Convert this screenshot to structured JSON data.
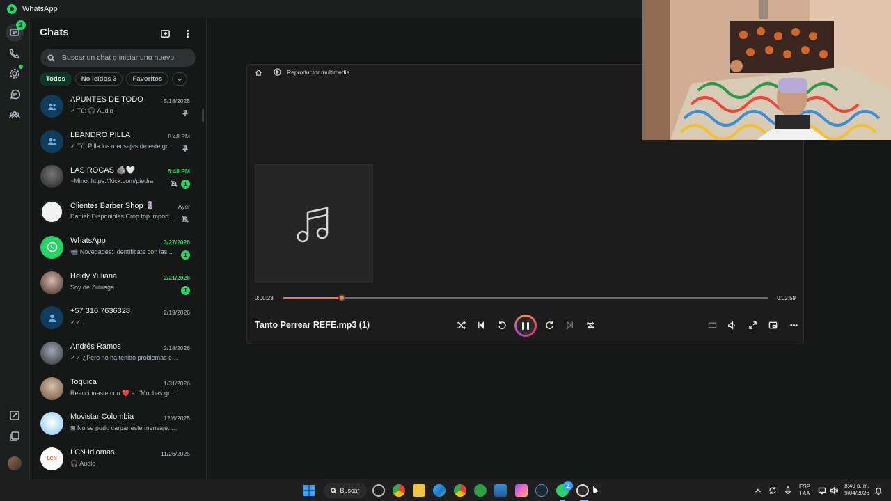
{
  "app": {
    "title": "WhatsApp"
  },
  "rail": {
    "chats_badge": "2"
  },
  "panel": {
    "title": "Chats",
    "search_placeholder": "Buscar un chat o iniciar uno nuevo",
    "filters": [
      {
        "label": "Todos",
        "active": true
      },
      {
        "label": "No leídos 3",
        "active": false
      },
      {
        "label": "Favoritos",
        "active": false
      }
    ]
  },
  "chats": [
    {
      "name": "APUNTES DE TODO",
      "preview": "✓ Tú: 🎧 Audio",
      "time": "5/18/2025",
      "unread": false,
      "badge": "",
      "icon": "pin-icon",
      "avatar": "group"
    },
    {
      "name": "LEANDRO PILLA",
      "preview": "✓ Tú: Pilla los mensajes de este gr...",
      "time": "8:48 PM",
      "unread": false,
      "badge": "",
      "icon": "pin-icon",
      "avatar": "group"
    },
    {
      "name": "LAS ROCAS 🪨🤍",
      "preview": "~Mino: https://kick.com/piedra",
      "time": "6:48 PM",
      "unread": true,
      "badge": "1",
      "icon": "mute-icon",
      "avatar": "photo-dark"
    },
    {
      "name": "Clientes Barber Shop 💈",
      "preview": "Daniel: Disponibles Crop top import...",
      "time": "Ayer",
      "unread": false,
      "badge": "",
      "icon": "mute-icon",
      "avatar": "logo-white"
    },
    {
      "name": "WhatsApp",
      "preview": "📹 Novedades: Identifícate con las...",
      "time": "3/27/2026",
      "unread": true,
      "badge": "1",
      "icon": "",
      "avatar": "whatsapp"
    },
    {
      "name": "Heidy Yuliana",
      "preview": "Soy de Zuluaga",
      "time": "2/21/2026",
      "unread": true,
      "badge": "1",
      "icon": "",
      "avatar": "photo-person"
    },
    {
      "name": "+57 310 7636328",
      "preview": "✓✓ .",
      "time": "2/19/2026",
      "unread": false,
      "badge": "",
      "icon": "",
      "avatar": "person"
    },
    {
      "name": "Andrés Ramos",
      "preview": "✓✓ ¿Pero no ha tenido problemas con ...",
      "time": "2/18/2026",
      "unread": false,
      "badge": "",
      "icon": "",
      "avatar": "photo-person2"
    },
    {
      "name": "Toquica",
      "preview": "Reaccionaste con ❤️ a: \"Muchas graci...",
      "time": "1/31/2026",
      "unread": false,
      "badge": "",
      "icon": "",
      "avatar": "photo-person3"
    },
    {
      "name": "Movistar Colombia",
      "preview": "⊠ No se pudo cargar este mensaje. A...",
      "time": "12/6/2025",
      "unread": false,
      "badge": "",
      "icon": "",
      "avatar": "photo-robot"
    },
    {
      "name": "LCN Idiomas",
      "preview": "🎧 Audio",
      "time": "11/26/2025",
      "unread": false,
      "badge": "",
      "icon": "",
      "avatar": "logo-lcn"
    }
  ],
  "player": {
    "app_name": "Reproductor multimedia",
    "track": "Tanto Perrear REFE.mp3 (1)",
    "current_time": "0:00:23",
    "total_time": "0:02:59",
    "progress": 0.12
  },
  "taskbar": {
    "search_label": "Buscar",
    "whatsapp_badge": "2",
    "lang_top": "ESP",
    "lang_bottom": "LAA",
    "clock_time": "8:49 p. m.",
    "clock_date": "9/04/2026"
  },
  "colors": {
    "accent_green": "#25d366",
    "seek_orange": "#ff7a3d",
    "background": "#161717"
  }
}
